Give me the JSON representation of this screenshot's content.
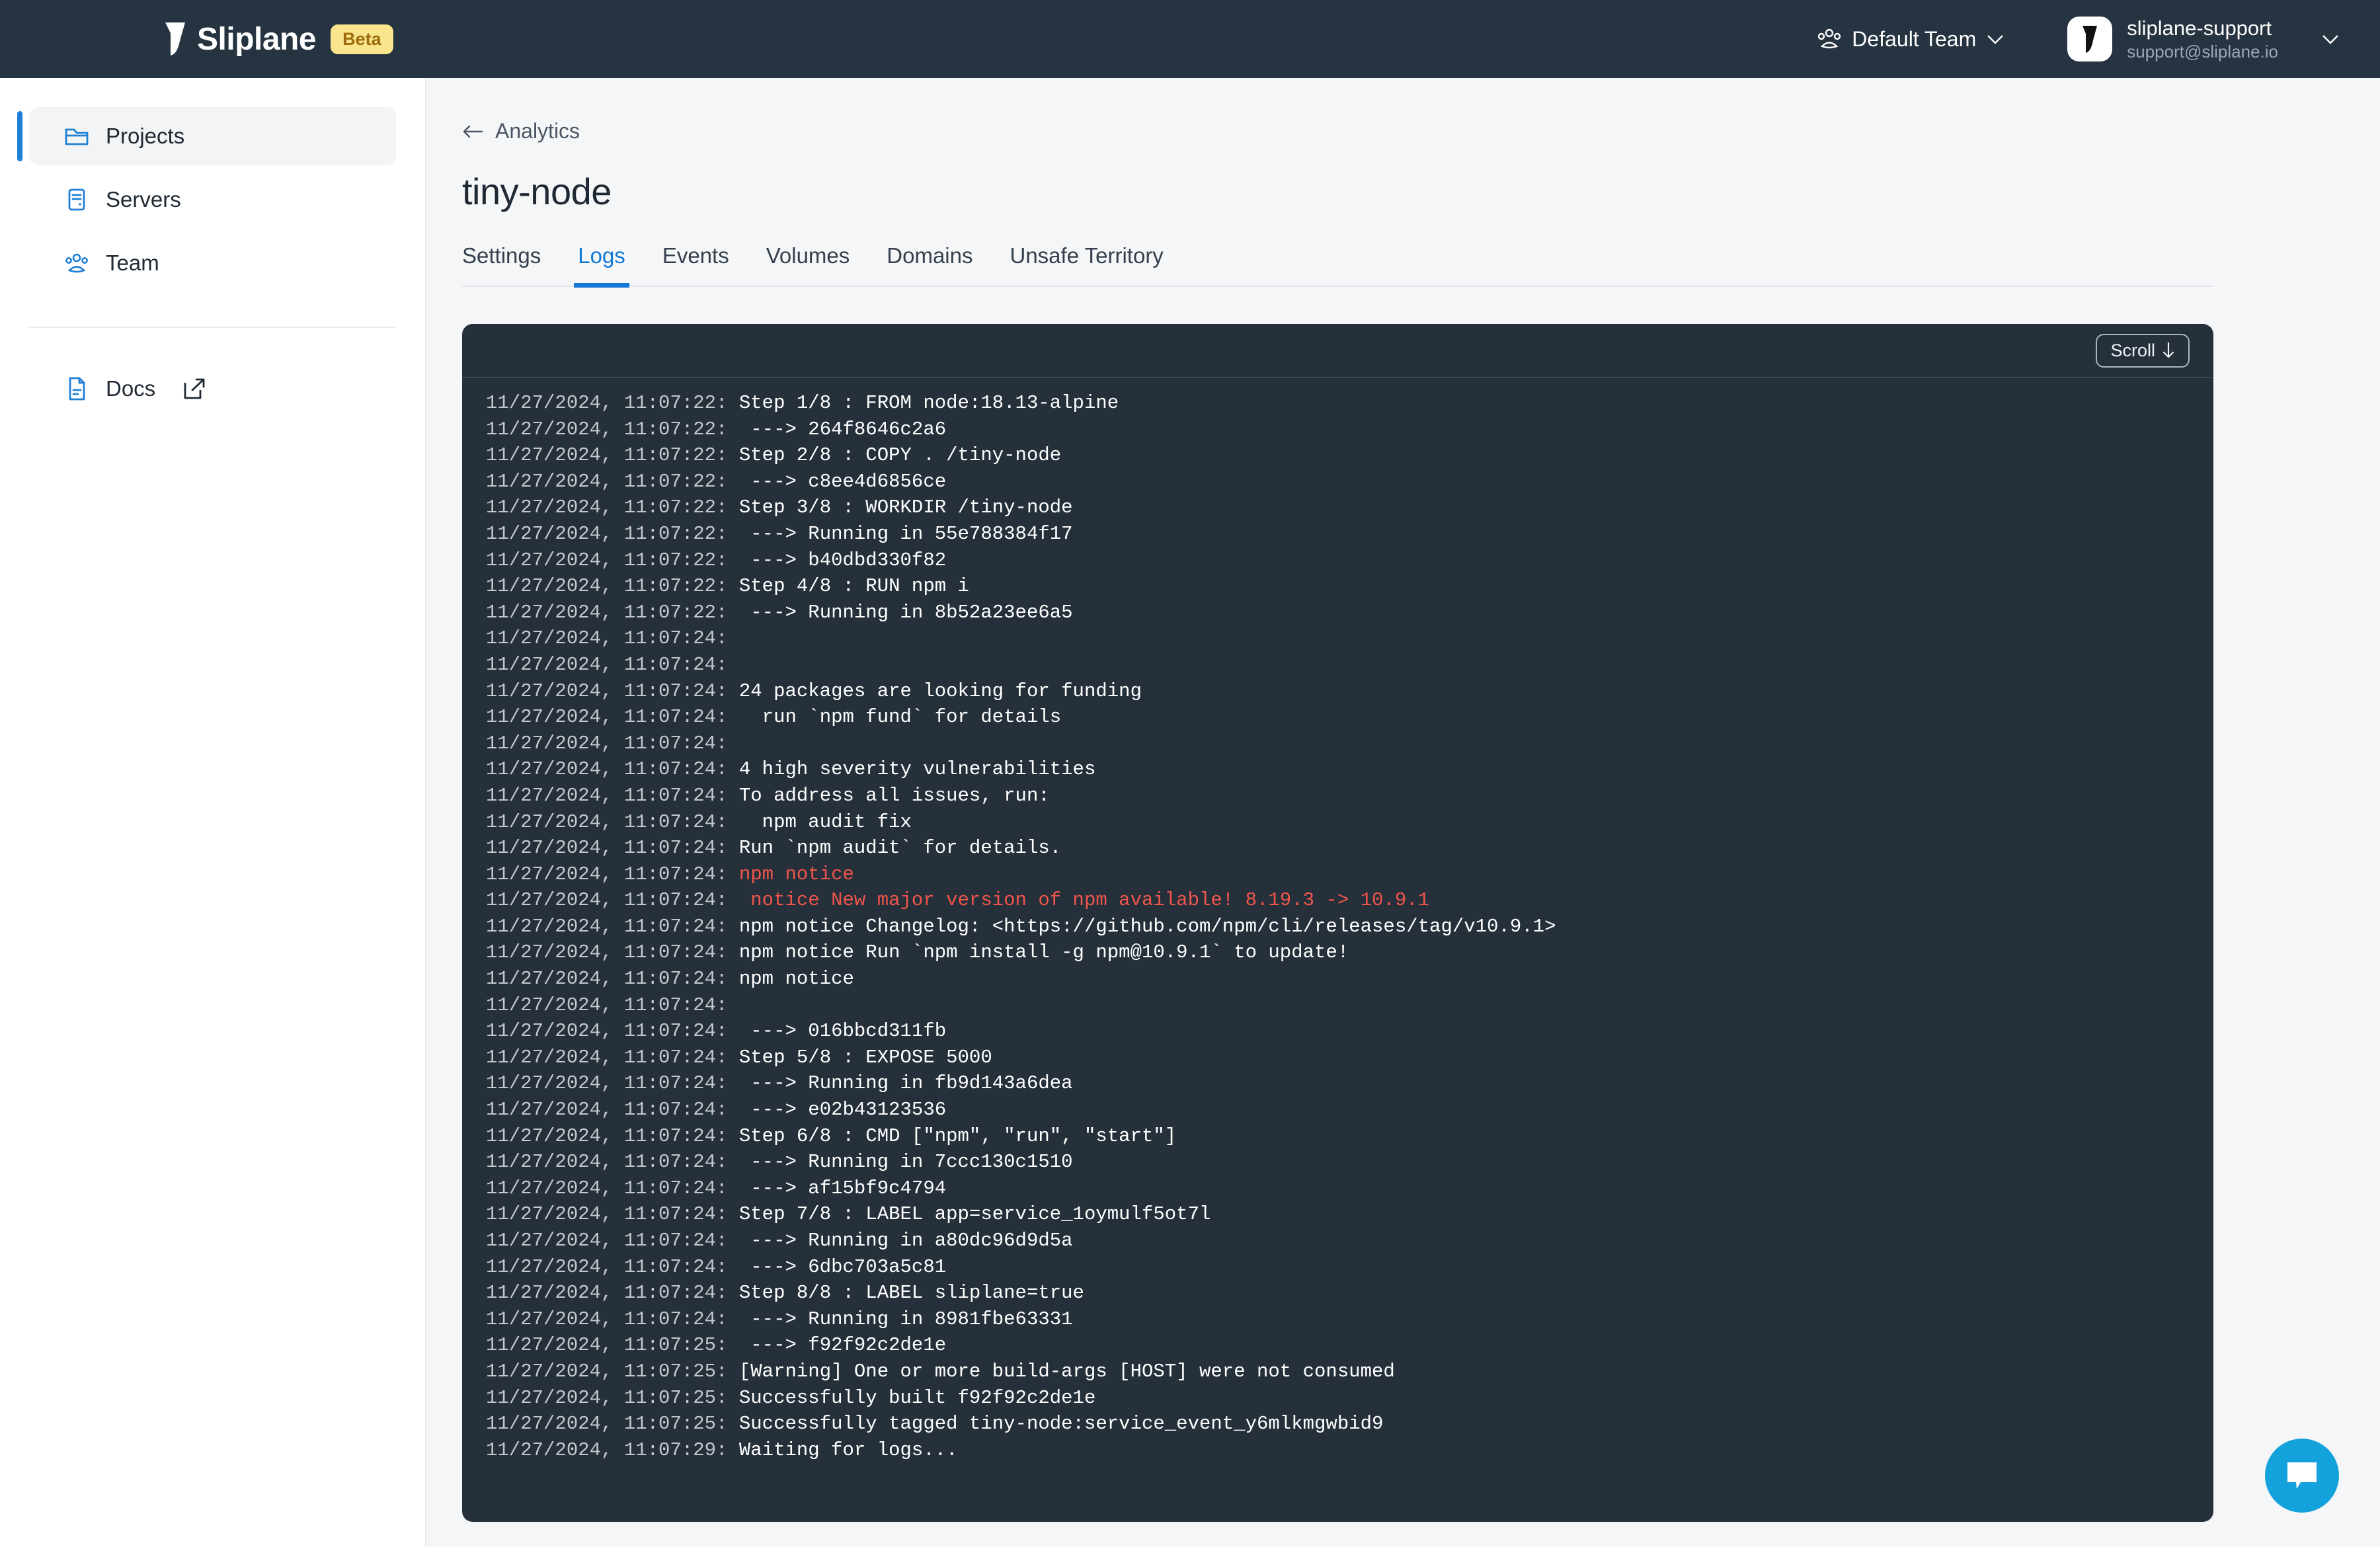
{
  "header": {
    "brand_name": "Sliplane",
    "brand_badge": "Beta",
    "brand_logo_icon": "sliplane-logo-mark",
    "team": {
      "icon": "people-group-icon",
      "label": "Default Team",
      "chevron_icon": "chevron-down-icon"
    },
    "user": {
      "avatar_icon": "sliplane-logo-mark",
      "name": "sliplane-support",
      "email": "support@sliplane.io",
      "chevron_icon": "chevron-down-icon"
    },
    "background_color": "#263340",
    "badge_bg_color": "#f8e58c",
    "badge_text_color": "#9c6a0a"
  },
  "sidebar": {
    "items": [
      {
        "label": "Projects",
        "icon": "folder-icon",
        "active": true
      },
      {
        "label": "Servers",
        "icon": "server-icon",
        "active": false
      },
      {
        "label": "Team",
        "icon": "people-group-icon",
        "active": false
      }
    ],
    "footer_items": [
      {
        "label": "Docs",
        "icon": "document-icon",
        "external_icon": "external-link-icon"
      }
    ],
    "accent_color": "#1f7fd4"
  },
  "main": {
    "breadcrumb": {
      "back_icon": "arrow-left-icon",
      "label": "Analytics"
    },
    "page_title": "tiny-node",
    "tabs": [
      {
        "label": "Settings",
        "active": false
      },
      {
        "label": "Logs",
        "active": true
      },
      {
        "label": "Events",
        "active": false
      },
      {
        "label": "Volumes",
        "active": false
      },
      {
        "label": "Domains",
        "active": false
      },
      {
        "label": "Unsafe Territory",
        "active": false
      }
    ],
    "active_tab_color": "#1278d4"
  },
  "log_panel": {
    "scroll_button": {
      "label": "Scroll",
      "icon": "arrow-down-icon"
    },
    "background_color": "#25303b",
    "timestamp_color": "#c3c8cc",
    "text_color": "#ffffff",
    "error_color": "#f0554b",
    "lines": [
      {
        "ts": "11/27/2024, 11:07:22:",
        "msg": " Step 1/8 : FROM node:18.13-alpine",
        "level": "info"
      },
      {
        "ts": "11/27/2024, 11:07:22:",
        "msg": "  ---> 264f8646c2a6",
        "level": "info"
      },
      {
        "ts": "11/27/2024, 11:07:22:",
        "msg": " Step 2/8 : COPY . /tiny-node",
        "level": "info"
      },
      {
        "ts": "11/27/2024, 11:07:22:",
        "msg": "  ---> c8ee4d6856ce",
        "level": "info"
      },
      {
        "ts": "11/27/2024, 11:07:22:",
        "msg": " Step 3/8 : WORKDIR /tiny-node",
        "level": "info"
      },
      {
        "ts": "11/27/2024, 11:07:22:",
        "msg": "  ---> Running in 55e788384f17",
        "level": "info"
      },
      {
        "ts": "11/27/2024, 11:07:22:",
        "msg": "  ---> b40dbd330f82",
        "level": "info"
      },
      {
        "ts": "11/27/2024, 11:07:22:",
        "msg": " Step 4/8 : RUN npm i",
        "level": "info"
      },
      {
        "ts": "11/27/2024, 11:07:22:",
        "msg": "  ---> Running in 8b52a23ee6a5",
        "level": "info"
      },
      {
        "ts": "11/27/2024, 11:07:24:",
        "msg": "",
        "level": "info"
      },
      {
        "ts": "11/27/2024, 11:07:24:",
        "msg": "",
        "level": "info"
      },
      {
        "ts": "11/27/2024, 11:07:24:",
        "msg": " 24 packages are looking for funding",
        "level": "info"
      },
      {
        "ts": "11/27/2024, 11:07:24:",
        "msg": "   run `npm fund` for details",
        "level": "info"
      },
      {
        "ts": "11/27/2024, 11:07:24:",
        "msg": "",
        "level": "info"
      },
      {
        "ts": "11/27/2024, 11:07:24:",
        "msg": " 4 high severity vulnerabilities",
        "level": "info"
      },
      {
        "ts": "11/27/2024, 11:07:24:",
        "msg": " To address all issues, run:",
        "level": "info"
      },
      {
        "ts": "11/27/2024, 11:07:24:",
        "msg": "   npm audit fix",
        "level": "info"
      },
      {
        "ts": "11/27/2024, 11:07:24:",
        "msg": " Run `npm audit` for details.",
        "level": "info"
      },
      {
        "ts": "11/27/2024, 11:07:24:",
        "msg": " npm notice",
        "level": "error"
      },
      {
        "ts": "11/27/2024, 11:07:24:",
        "msg": "  notice New major version of npm available! 8.19.3 -> 10.9.1",
        "level": "error"
      },
      {
        "ts": "11/27/2024, 11:07:24:",
        "msg": " npm notice Changelog: <https://github.com/npm/cli/releases/tag/v10.9.1>",
        "level": "info"
      },
      {
        "ts": "11/27/2024, 11:07:24:",
        "msg": " npm notice Run `npm install -g npm@10.9.1` to update!",
        "level": "info"
      },
      {
        "ts": "11/27/2024, 11:07:24:",
        "msg": " npm notice",
        "level": "info"
      },
      {
        "ts": "11/27/2024, 11:07:24:",
        "msg": "",
        "level": "info"
      },
      {
        "ts": "11/27/2024, 11:07:24:",
        "msg": "  ---> 016bbcd311fb",
        "level": "info"
      },
      {
        "ts": "11/27/2024, 11:07:24:",
        "msg": " Step 5/8 : EXPOSE 5000",
        "level": "info"
      },
      {
        "ts": "11/27/2024, 11:07:24:",
        "msg": "  ---> Running in fb9d143a6dea",
        "level": "info"
      },
      {
        "ts": "11/27/2024, 11:07:24:",
        "msg": "  ---> e02b43123536",
        "level": "info"
      },
      {
        "ts": "11/27/2024, 11:07:24:",
        "msg": " Step 6/8 : CMD [\"npm\", \"run\", \"start\"]",
        "level": "info"
      },
      {
        "ts": "11/27/2024, 11:07:24:",
        "msg": "  ---> Running in 7ccc130c1510",
        "level": "info"
      },
      {
        "ts": "11/27/2024, 11:07:24:",
        "msg": "  ---> af15bf9c4794",
        "level": "info"
      },
      {
        "ts": "11/27/2024, 11:07:24:",
        "msg": " Step 7/8 : LABEL app=service_1oymulf5ot7l",
        "level": "info"
      },
      {
        "ts": "11/27/2024, 11:07:24:",
        "msg": "  ---> Running in a80dc96d9d5a",
        "level": "info"
      },
      {
        "ts": "11/27/2024, 11:07:24:",
        "msg": "  ---> 6dbc703a5c81",
        "level": "info"
      },
      {
        "ts": "11/27/2024, 11:07:24:",
        "msg": " Step 8/8 : LABEL sliplane=true",
        "level": "info"
      },
      {
        "ts": "11/27/2024, 11:07:24:",
        "msg": "  ---> Running in 8981fbe63331",
        "level": "info"
      },
      {
        "ts": "11/27/2024, 11:07:25:",
        "msg": "  ---> f92f92c2de1e",
        "level": "info"
      },
      {
        "ts": "11/27/2024, 11:07:25:",
        "msg": " [Warning] One or more build-args [HOST] were not consumed",
        "level": "info"
      },
      {
        "ts": "11/27/2024, 11:07:25:",
        "msg": " Successfully built f92f92c2de1e",
        "level": "info"
      },
      {
        "ts": "11/27/2024, 11:07:25:",
        "msg": " Successfully tagged tiny-node:service_event_y6mlkmgwbid9",
        "level": "info"
      },
      {
        "ts": "11/27/2024, 11:07:29:",
        "msg": " Waiting for logs...",
        "level": "info"
      }
    ]
  },
  "chat_widget": {
    "icon": "chat-bubble-icon",
    "color": "#14a2dc"
  }
}
